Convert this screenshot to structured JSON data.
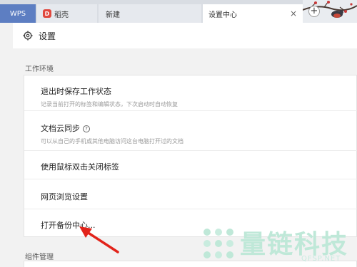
{
  "tabs": {
    "wps": "WPS",
    "doc": "稻壳",
    "new": "新建",
    "settings": "设置中心",
    "close": "×",
    "add": "+"
  },
  "header": {
    "title": "设置"
  },
  "sections": {
    "work_env": "工作环境",
    "components": "组件管理"
  },
  "items": [
    {
      "title": "退出时保存工作状态",
      "subtitle": "记录当前打开的标签和编辑状态，下次启动时自动恢复"
    },
    {
      "title": "文档云同步",
      "subtitle": "可以从自己的手机或其他电脑访问这台电脑打开过的文档"
    },
    {
      "title": "使用鼠标双击关闭标签",
      "subtitle": ""
    },
    {
      "title": "网页浏览设置",
      "subtitle": ""
    },
    {
      "title": "打开备份中心...",
      "subtitle": ""
    }
  ],
  "watermark": {
    "main": "量链科技",
    "sub": "QFSP.NET"
  },
  "colors": {
    "accent": "#5d7ec2",
    "arrow": "#e2231a",
    "watermark": "#bfe8d8"
  }
}
